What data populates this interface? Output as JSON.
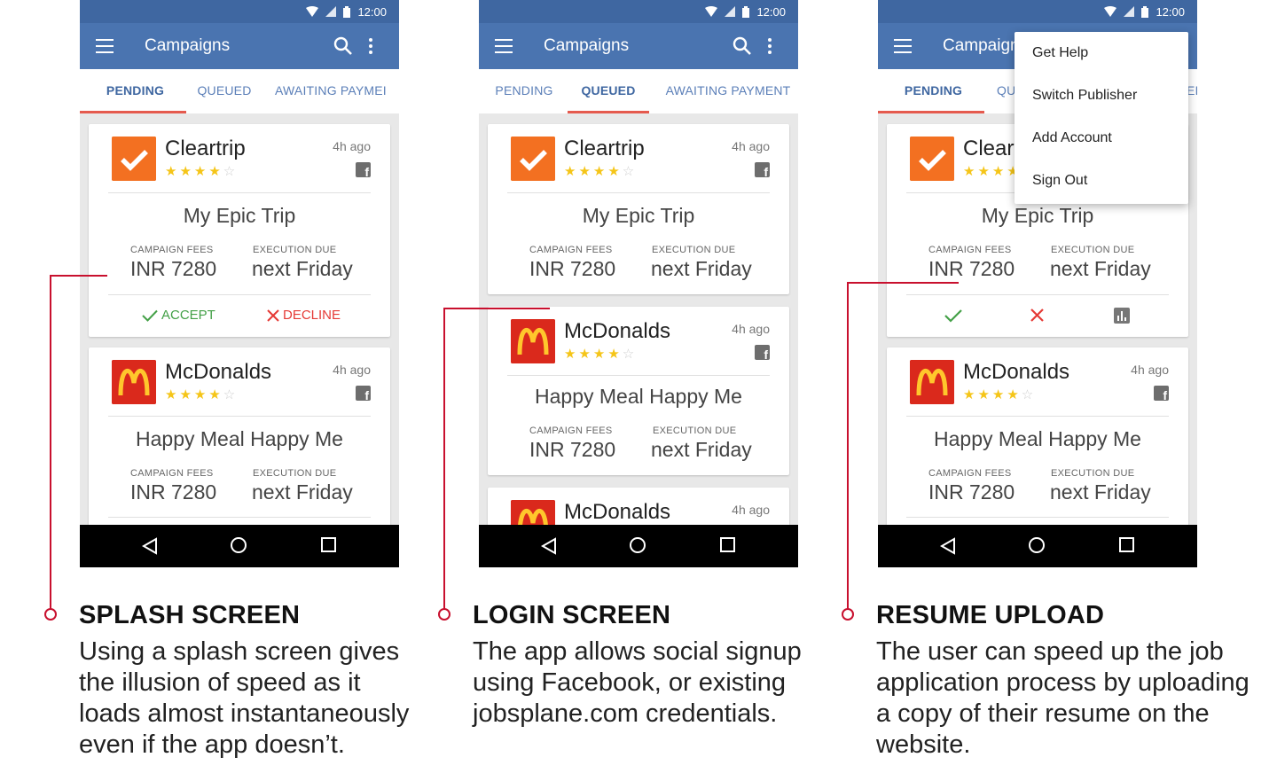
{
  "status": {
    "time": "12:00"
  },
  "app": {
    "title": "Campaigns",
    "tabs": [
      "PENDING",
      "QUEUED",
      "AWAITING PAYMENT"
    ],
    "tabs_cut": [
      "PENDING",
      "QUEUED",
      "AWAITING PAYMEI"
    ],
    "tabs_menu": [
      "PENDING",
      "QU",
      "EI"
    ]
  },
  "cards": {
    "cleartrip": {
      "brand": "Cleartrip",
      "brand_cut": "Cleartr",
      "time": "4h ago",
      "rating": 4,
      "rating_max": 5,
      "campaign": "My Epic Trip",
      "fees_label": "CAMPAIGN FEES",
      "fees": "INR 7280",
      "due_label": "EXECUTION DUE",
      "due": "next Friday"
    },
    "mcdonalds": {
      "brand": "McDonalds",
      "time": "4h ago",
      "rating": 4,
      "rating_max": 5,
      "campaign": "Happy Meal Happy Me",
      "fees_label": "CAMPAIGN FEES",
      "fees": "INR 7280",
      "due_label": "EXECUTION DUE",
      "due": "next Friday"
    }
  },
  "actions": {
    "accept": "ACCEPT",
    "decline": "DECLINE"
  },
  "overflow_menu": [
    "Get Help",
    "Switch Publisher",
    "Add Account",
    "Sign Out"
  ],
  "captions": [
    {
      "title": "SPLASH SCREEN",
      "body": [
        "Using a splash screen gives",
        "the illusion of speed as it",
        "loads almost instantaneously",
        "even if the app doesn’t."
      ]
    },
    {
      "title": "LOGIN SCREEN",
      "body": [
        "The app allows social signup",
        "using Facebook, or existing",
        "jobsplane.com credentials."
      ]
    },
    {
      "title": "RESUME UPLOAD",
      "body": [
        "The user can speed up the job",
        "application process by uploading",
        "a copy of their resume on the",
        "website."
      ]
    }
  ],
  "colors": {
    "app_bar": "#4a74b0",
    "status_bar": "#3f67a1",
    "tab_indicator": "#e55a4e",
    "accent_red": "#c8102e",
    "accept": "#43a047",
    "decline": "#e53935",
    "star": "#f5c518"
  },
  "icons": [
    "hamburger-menu-icon",
    "search-icon",
    "more-vert-icon",
    "wifi-icon",
    "signal-icon",
    "battery-icon",
    "facebook-icon",
    "check-icon",
    "close-icon",
    "bar-chart-icon",
    "back-icon",
    "home-icon",
    "recents-icon"
  ]
}
